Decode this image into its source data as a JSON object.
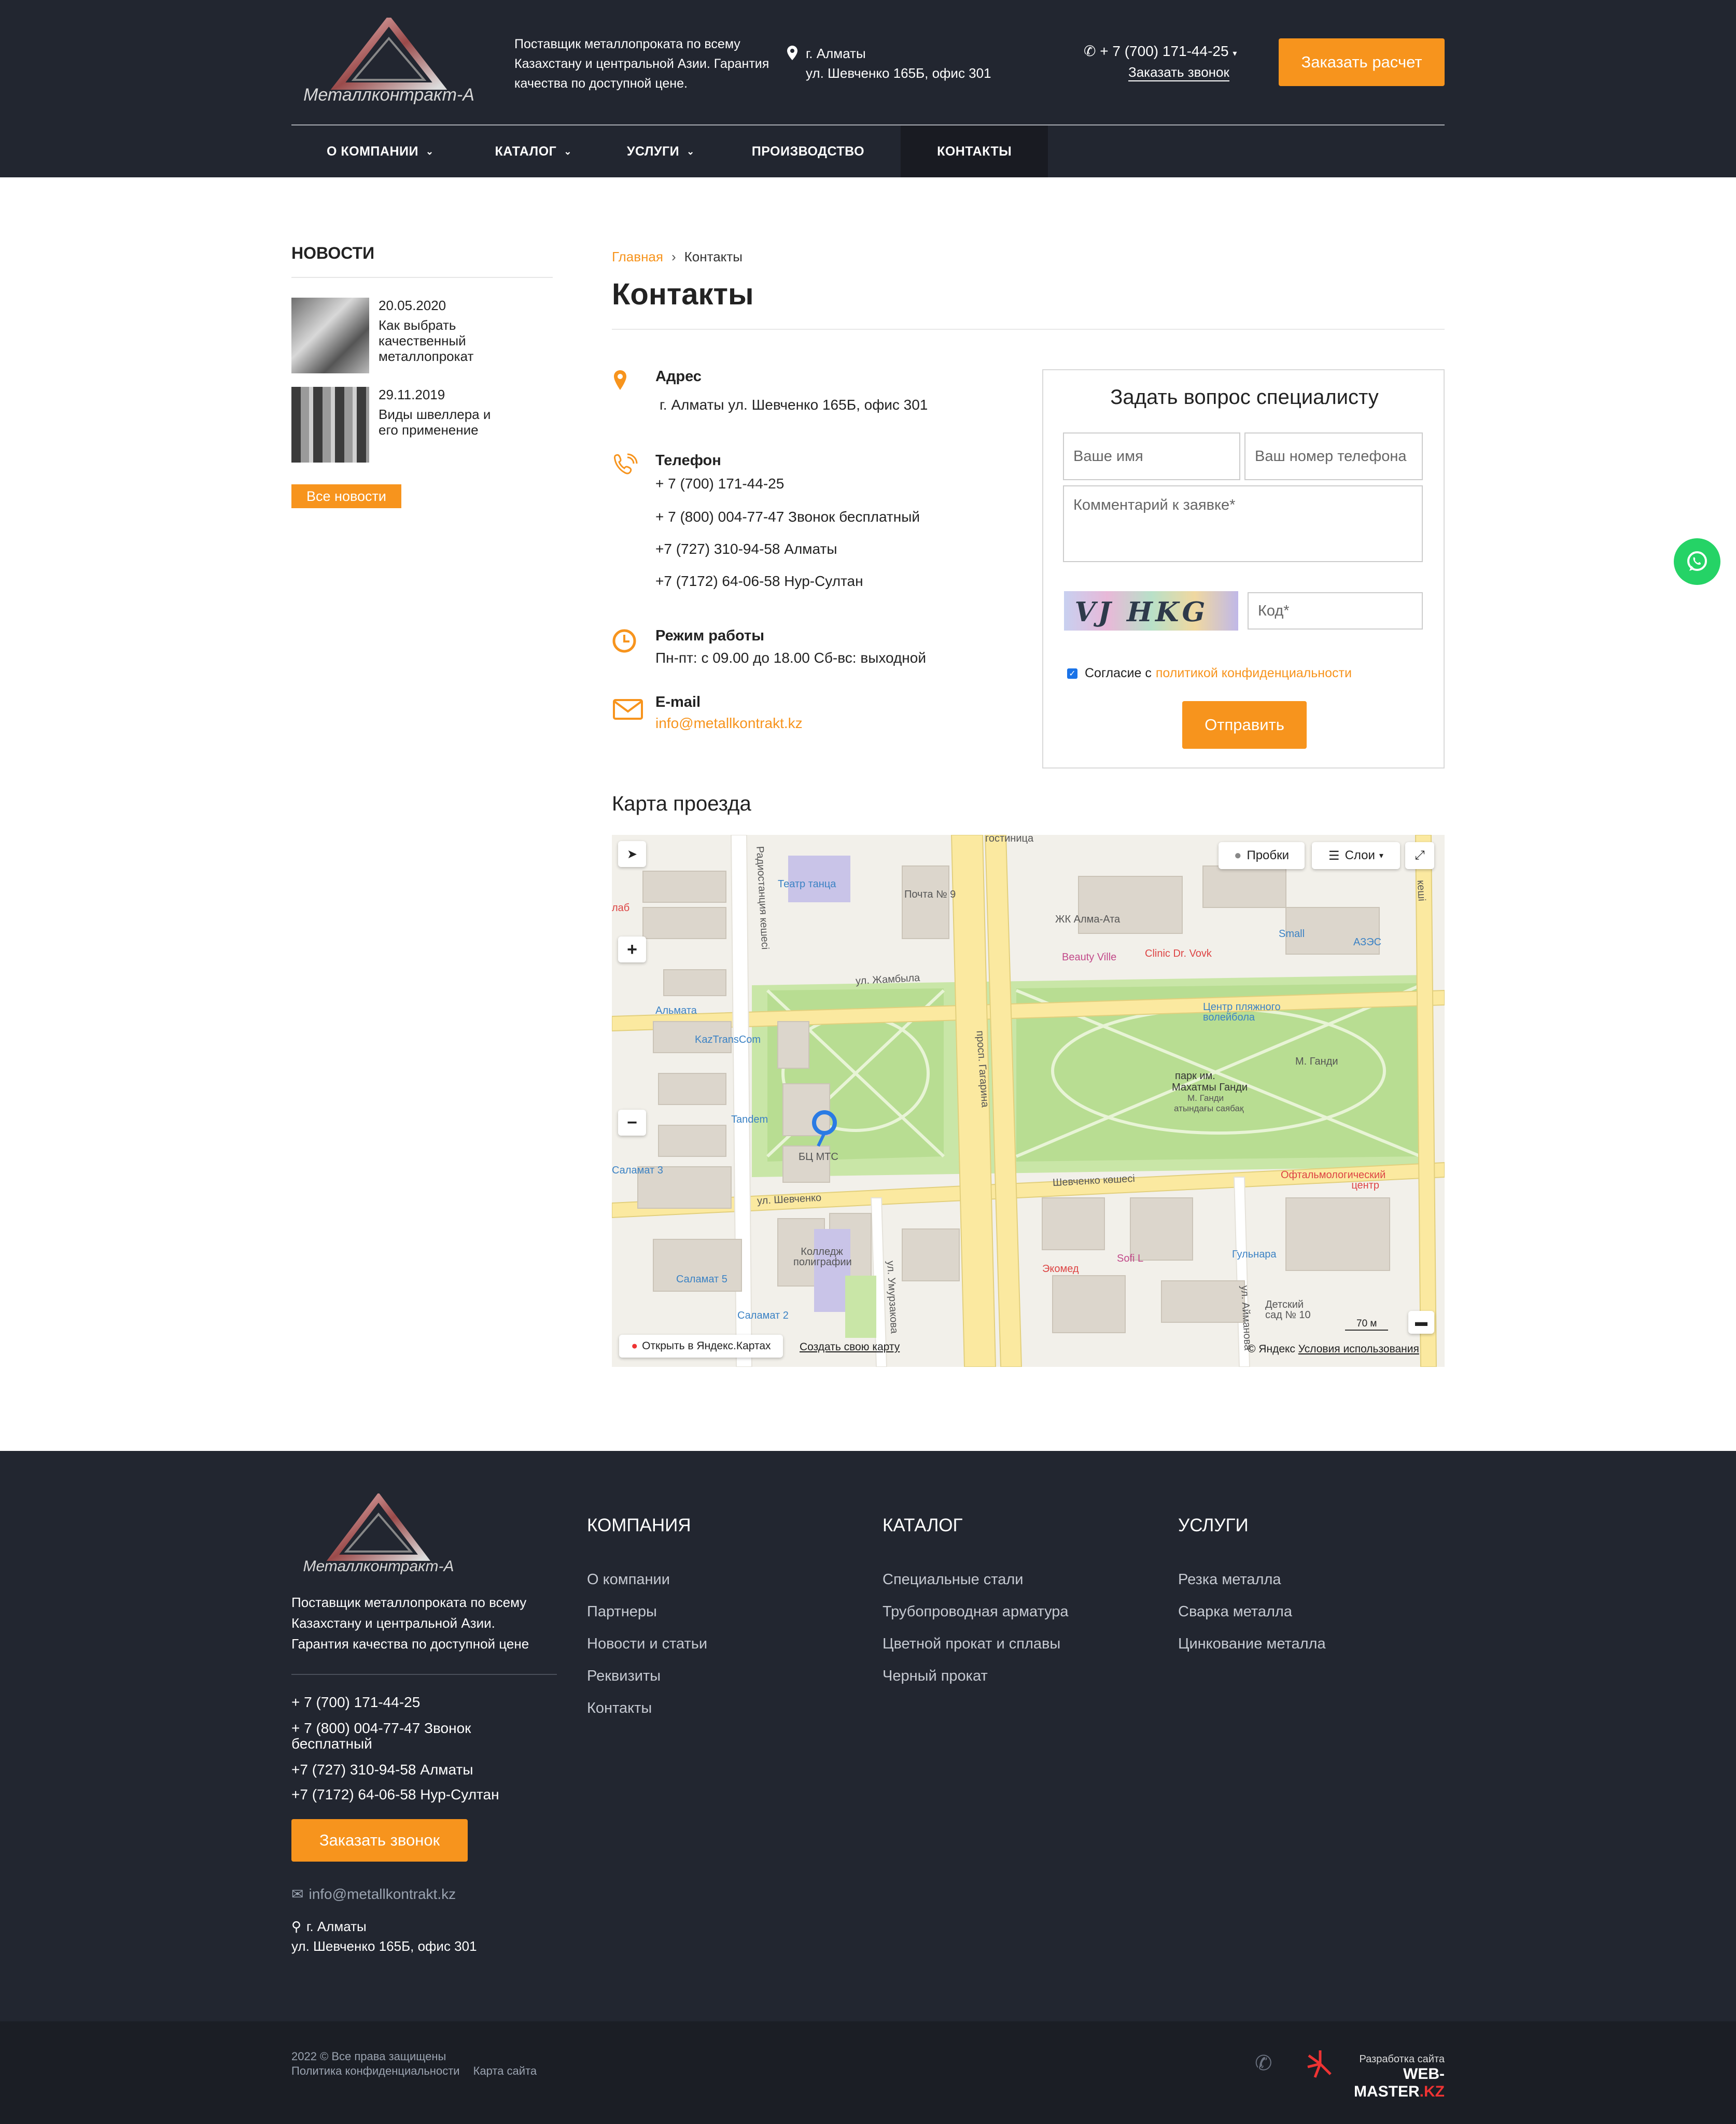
{
  "header": {
    "logo_text": "Металлконтракт-А",
    "tagline": "Поставщик металлопроката по всему Казахстану и центральной Азии. Гарантия качества по доступной цене.",
    "city": "г. Алматы",
    "street": "ул. Шевченко 165Б, офис 301",
    "phone": "+ 7 (700) 171-44-25",
    "callback": "Заказать звонок",
    "order_button": "Заказать расчет",
    "nav": [
      {
        "label": "О КОМПАНИИ",
        "dropdown": true
      },
      {
        "label": "КАТАЛОГ",
        "dropdown": true
      },
      {
        "label": "УСЛУГИ",
        "dropdown": true
      },
      {
        "label": "ПРОИЗВОДСТВО",
        "dropdown": false
      },
      {
        "label": "КОНТАКТЫ",
        "dropdown": false,
        "active": true
      }
    ]
  },
  "sidebar": {
    "title": "НОВОСТИ",
    "news": [
      {
        "date": "20.05.2020",
        "title": "Как выбрать качественный металлопрокат"
      },
      {
        "date": "29.11.2019",
        "title": "Виды швеллера и его применение"
      }
    ],
    "all_news": "Все новости"
  },
  "breadcrumb": {
    "home": "Главная",
    "current": "Контакты"
  },
  "page_title": "Контакты",
  "contacts": {
    "address_label": "Адрес",
    "address": "г. Алматы ул. Шевченко 165Б, офис 301",
    "phone_label": "Телефон",
    "phones": [
      "+ 7 (700) 171-44-25",
      "+ 7 (800) 004-77-47 Звонок бесплатный",
      "+7 (727) 310-94-58 Алматы",
      "+7 (7172) 64-06-58 Нур-Султан"
    ],
    "hours_label": "Режим работы",
    "hours": "Пн-пт: с 09.00 до 18.00 Сб-вс: выходной",
    "email_label": "E-mail",
    "email": "info@metallkontrakt.kz"
  },
  "form": {
    "title": "Задать вопрос специалисту",
    "name_placeholder": "Ваше имя",
    "phone_placeholder": "Ваш номер телефона",
    "comment_placeholder": "Комментарий к заявке*",
    "captcha_text": "VJ HKG",
    "code_placeholder": "Код*",
    "agree_text": "Согласие с",
    "agree_link": "политикой конфиденциальности",
    "agree_checked": true,
    "submit": "Отправить"
  },
  "map": {
    "title": "Карта проезда",
    "traffic": "Пробки",
    "layers": "Слои",
    "open_link": "Открыть в Яндекс.Картах",
    "create_link": "Создать свою карту",
    "copyright": "© Яндекс",
    "terms": "Условия использования",
    "scale": "70 м",
    "labels": {
      "zhambyla": "ул. Жамбыла",
      "gagarina": "просп. Гагарина",
      "shevchenko": "ул. Шевченко",
      "shevchenko_kz": "Шевченко көшесі",
      "radiostancii": "Радиостанция кешесі",
      "umurzakov": "ул. Умурзакова",
      "aimanova": "ул. Айманова",
      "teatr": "Театр танца",
      "pochta": "Почта № 9",
      "zhk": "ЖК Алма-Ата",
      "beauty": "Beauty Ville",
      "clinic": "Clinic Dr. Vovk",
      "small": "Small",
      "azs": "АЗЭС",
      "almata": "Альмата",
      "kaztrans": "KazTransCom",
      "tandem": "Tandem",
      "bc": "БЦ МТС",
      "volley": "Центр пляжного волейбола",
      "park1": "парк им.",
      "park2": "Махатмы Ганди",
      "park3": "М. Ганди",
      "park4": "атындағы саябақ",
      "gandi": "М. Ганди",
      "ophth": "Офтальмологический центр",
      "college": "Колледж полиграфии",
      "ekomed": "Экомед",
      "sofi": "Sofi L",
      "gulnara": "Гульнара",
      "sad": "Детский сад № 10",
      "salamat5": "Саламат 5",
      "salamat2": "Саламат 2",
      "salamat3": "Саламат 3",
      "gostinica": "гостиница",
      "lab": "лаб",
      "kuna": "кеші"
    }
  },
  "footer": {
    "logo_text": "Металлконтракт-А",
    "description": "Поставщик металлопроката по всему Казахстану и центральной Азии. Гарантия качества по доступной цене",
    "phones": [
      "+ 7 (700) 171-44-25",
      "+ 7 (800) 004-77-47 Звонок бесплатный",
      "+7 (727) 310-94-58 Алматы",
      "+7 (7172) 64-06-58 Нур-Султан"
    ],
    "callback_button": "Заказать звонок",
    "email": "info@metallkontrakt.kz",
    "city": "г. Алматы",
    "street": "ул. Шевченко 165Б, офис 301",
    "columns": [
      {
        "title": "КОМПАНИЯ",
        "items": [
          "О компании",
          "Партнеры",
          "Новости и статьи",
          "Реквизиты",
          "Контакты"
        ]
      },
      {
        "title": "КАТАЛОГ",
        "items": [
          "Специальные стали",
          "Трубопроводная арматура",
          "Цветной прокат и сплавы",
          "Черный прокат"
        ]
      },
      {
        "title": "УСЛУГИ",
        "items": [
          "Резка металла",
          "Сварка металла",
          "Цинкование металла"
        ]
      }
    ],
    "copyright": "2022 © Все права защищены",
    "privacy": "Политика конфиденциальности",
    "sitemap": "Карта сайта",
    "dev_label": "Разработка сайта",
    "dev_name": "WEB-MASTER",
    "dev_tld": ".KZ"
  },
  "colors": {
    "accent": "#f7941d",
    "dark": "#222630",
    "whatsapp": "#25d366"
  }
}
